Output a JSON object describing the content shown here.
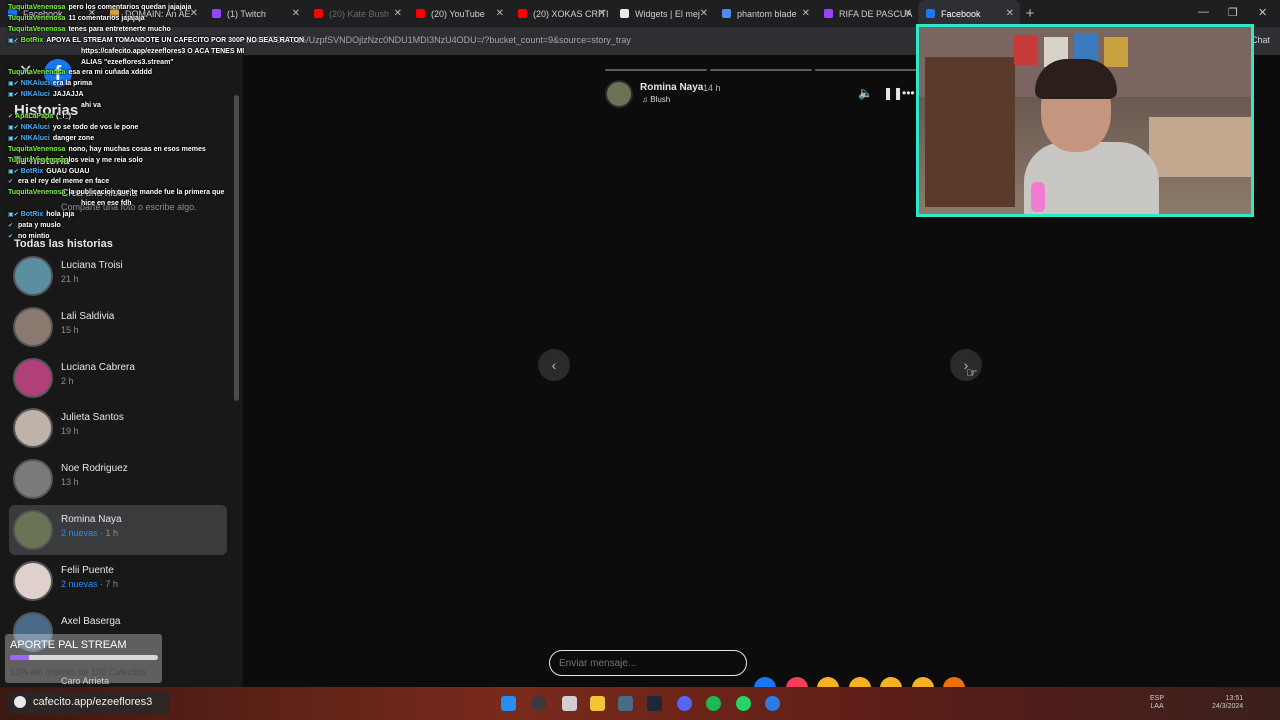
{
  "browser": {
    "tabs": [
      {
        "label": "Facebook",
        "color": "#1877f2",
        "dim": false
      },
      {
        "label": "DOMAIN: An AE",
        "color": "#d8a040",
        "dim": false
      },
      {
        "label": "(1) Twitch",
        "color": "#9146ff",
        "dim": false
      },
      {
        "label": "(20) Kate Bush",
        "color": "#ff0000",
        "dim": true
      },
      {
        "label": "(20) YouTube",
        "color": "#ff0000",
        "dim": false
      },
      {
        "label": "(20) XOKAS CRITI",
        "color": "#ff0000",
        "dim": false
      },
      {
        "label": "Widgets | El mej",
        "color": "#e8e8e8",
        "dim": false
      },
      {
        "label": "phantom blade",
        "color": "#4b8bf5",
        "dim": false
      },
      {
        "label": "RIFA DE PASCUA",
        "color": "#9146ff",
        "dim": false
      },
      {
        "label": "Facebook",
        "color": "#1877f2",
        "dim": false,
        "active": true
      }
    ],
    "new_tab": "+",
    "url": "524657967015/UzpfSVNDOjlzNzc0NDU1MDI3NzU4ODU=/?bucket_count=9&source=story_tray",
    "chat_button": "Chat"
  },
  "sidebar": {
    "title": "Historias",
    "your_story": "Tu historia",
    "create_story": "Crea una historia",
    "create_story_sub": "Comparte una foto o escribe algo.",
    "all_stories": "Todas las historias",
    "stories": [
      {
        "name": "Luciana Troisi",
        "time": "21 h",
        "new": "",
        "color": "#5b8fa0",
        "selected": false
      },
      {
        "name": "Lali Saldivia",
        "time": "15 h",
        "new": "",
        "color": "#8a7a70",
        "selected": false
      },
      {
        "name": "Luciana Cabrera",
        "time": "2 h",
        "new": "",
        "color": "#b0407a",
        "selected": false
      },
      {
        "name": "Julieta Santos",
        "time": "19 h",
        "new": "",
        "color": "#bfb2a8",
        "selected": false
      },
      {
        "name": "Noe Rodriguez",
        "time": "13 h",
        "new": "",
        "color": "#7a7a7a",
        "selected": false
      },
      {
        "name": "Romina Naya",
        "time": "1 h",
        "new": "2 nuevas",
        "color": "#6b7357",
        "selected": true
      },
      {
        "name": "Felii Puente",
        "time": "7 h",
        "new": "2 nuevas",
        "color": "#e0d0cc",
        "selected": false
      },
      {
        "name": "Axel Baserga",
        "time": "",
        "new": "",
        "color": "#4a6a8a",
        "selected": false
      }
    ],
    "last_partial": "Caro Arrieta"
  },
  "chat": [
    {
      "user": "TuquitaVenenosa",
      "msg": "pero los comentarios quedan jajajaja",
      "badge": "",
      "cls": ""
    },
    {
      "user": "TuquitaVenenosa",
      "msg": "11 comentarios jajajaja",
      "badge": "",
      "cls": ""
    },
    {
      "user": "TuquitaVenenosa",
      "msg": "tenes para entretenerte mucho",
      "badge": "",
      "cls": ""
    },
    {
      "user": "BotRix",
      "msg": "APOYA EL STREAM TOMANDOTE UN CAFECITO POR 300P NO SEAS RATON",
      "badge": "▣✔",
      "cls": ""
    },
    {
      "user": "",
      "msg": "https://cafecito.app/ezeeflores3 O ACA TENES MI",
      "badge": "",
      "cls": ""
    },
    {
      "user": "",
      "msg": "ALIAS \"ezeeflores3.stream\"",
      "badge": "",
      "cls": ""
    },
    {
      "user": "TuquitaVenenosa",
      "msg": "esa era mi cuñada xdddd",
      "badge": "",
      "cls": ""
    },
    {
      "user": "NIKAluci",
      "msg": "era la prima",
      "badge": "▣✔",
      "cls": "blue"
    },
    {
      "user": "NIKAluci",
      "msg": "JAJAJJA",
      "badge": "▣✔",
      "cls": "blue"
    },
    {
      "user": "",
      "msg": "ahi va",
      "badge": "",
      "cls": ""
    },
    {
      "user": "ApaLaPapa",
      "msg": "(_!_)",
      "badge": "✔",
      "cls": ""
    },
    {
      "user": "NIKAluci",
      "msg": "yo se todo de vos le pone",
      "badge": "▣✔",
      "cls": "blue"
    },
    {
      "user": "NIKAluci",
      "msg": "danger zone",
      "badge": "▣✔",
      "cls": "blue"
    },
    {
      "user": "TuquitaVenenosa",
      "msg": "nono, hay muchas cosas en esos memes",
      "badge": "",
      "cls": ""
    },
    {
      "user": "TuquitaVenenosa",
      "msg": "los veia y me reia solo",
      "badge": "",
      "cls": ""
    },
    {
      "user": "BotRix",
      "msg": "GUAU GUAU",
      "badge": "▣✔",
      "cls": "blue"
    },
    {
      "user": "",
      "msg": "era el rey del meme en face",
      "badge": "✔",
      "cls": "red"
    },
    {
      "user": "TuquitaVenenosa",
      "msg": "la publicacion que te mande fue la primera que",
      "badge": "",
      "cls": ""
    },
    {
      "user": "",
      "msg": "hice en ese fdh",
      "badge": "",
      "cls": ""
    },
    {
      "user": "BotRix",
      "msg": "hola jaja",
      "badge": "▣✔",
      "cls": "blue"
    },
    {
      "user": "",
      "msg": "pata y muslo",
      "badge": "✔",
      "cls": "red"
    },
    {
      "user": "",
      "msg": "no mintio",
      "badge": "✔",
      "cls": "red"
    }
  ],
  "viewer": {
    "name": "Romina Naya",
    "time": "14 h",
    "music": "♫ Blush",
    "message_placeholder": "Enviar mensaje...",
    "reactions": [
      "#1877f2",
      "#f33e58",
      "#f7b125",
      "#f7b125",
      "#f7b125",
      "#f7b125",
      "#e9710f"
    ]
  },
  "donation": {
    "title": "APORTE PAL STREAM",
    "progress_fraction": 0.13,
    "subtitle": "13% del objetivo de 100 Cafecitos"
  },
  "taskbar": {
    "cafecito": "cafecito.app/ezeeflores3",
    "lang_top": "ESP",
    "lang_bottom": "LAA",
    "time": "13:51",
    "date": "24/3/2024"
  }
}
